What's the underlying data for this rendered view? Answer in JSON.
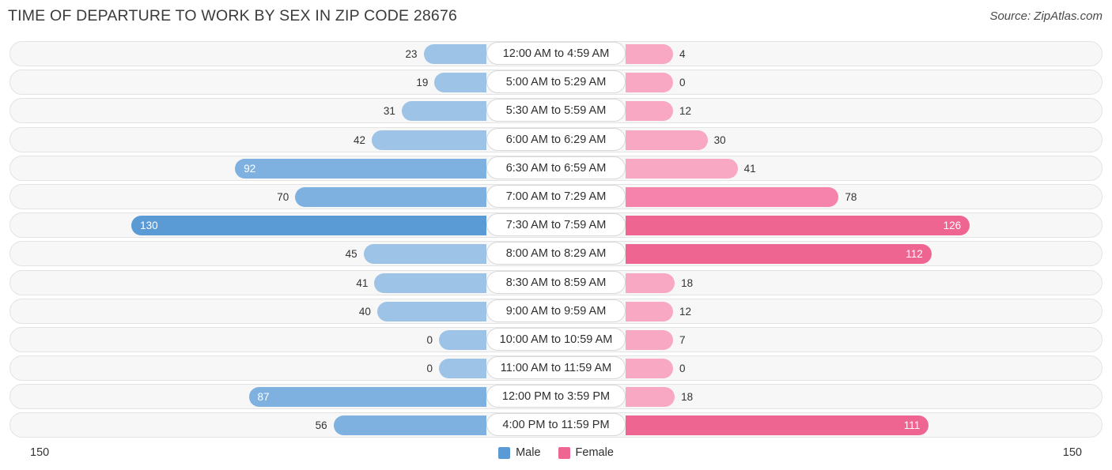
{
  "header": {
    "title": "TIME OF DEPARTURE TO WORK BY SEX IN ZIP CODE 28676",
    "source": "Source: ZipAtlas.com"
  },
  "axis": {
    "left_max": "150",
    "right_max": "150",
    "max_value": 150
  },
  "legend": {
    "items": [
      {
        "label": "Male",
        "color": "#5b9bd5"
      },
      {
        "label": "Female",
        "color": "#ef6592"
      }
    ]
  },
  "colors": {
    "male_light": "#9dc3e6",
    "male_mid": "#7eb0e0",
    "male_dark": "#5b9bd5",
    "female_light": "#f9a8c4",
    "female_mid": "#f583ab",
    "female_dark": "#ef6592",
    "track_bg": "#f7f7f7",
    "track_border": "#e3e3e3",
    "pill_bg": "#ffffff",
    "pill_border": "#d8d8d8"
  },
  "chart_data": {
    "type": "bar",
    "title": "TIME OF DEPARTURE TO WORK BY SEX IN ZIP CODE 28676",
    "subtitle": "",
    "xlabel": "",
    "ylabel": "",
    "orientation": "horizontal-diverging",
    "xlim": [
      -150,
      150
    ],
    "grid": false,
    "legend_position": "bottom-center",
    "categories": [
      "12:00 AM to 4:59 AM",
      "5:00 AM to 5:29 AM",
      "5:30 AM to 5:59 AM",
      "6:00 AM to 6:29 AM",
      "6:30 AM to 6:59 AM",
      "7:00 AM to 7:29 AM",
      "7:30 AM to 7:59 AM",
      "8:00 AM to 8:29 AM",
      "8:30 AM to 8:59 AM",
      "9:00 AM to 9:59 AM",
      "10:00 AM to 10:59 AM",
      "11:00 AM to 11:59 AM",
      "12:00 PM to 3:59 PM",
      "4:00 PM to 11:59 PM"
    ],
    "series": [
      {
        "name": "Male",
        "color": "#5b9bd5",
        "values": [
          23,
          19,
          31,
          42,
          92,
          70,
          130,
          45,
          41,
          40,
          0,
          0,
          87,
          56
        ]
      },
      {
        "name": "Female",
        "color": "#ef6592",
        "values": [
          4,
          0,
          12,
          30,
          41,
          78,
          126,
          112,
          18,
          12,
          7,
          0,
          18,
          111
        ]
      }
    ]
  }
}
